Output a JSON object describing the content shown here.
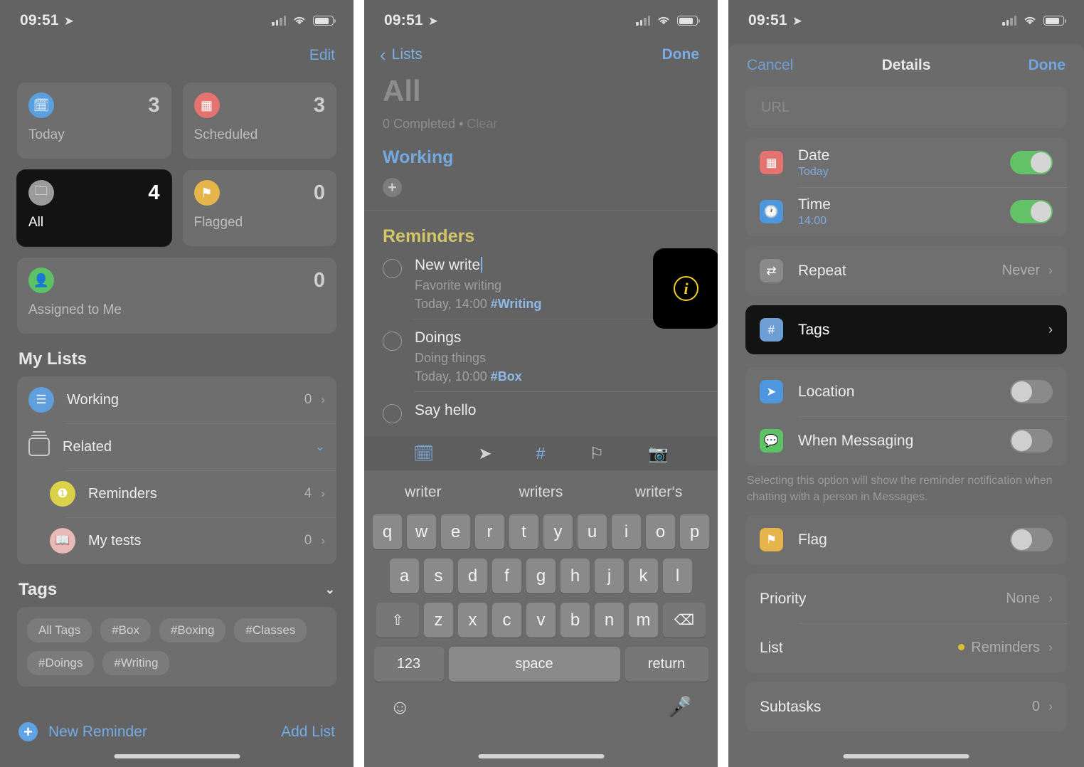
{
  "status_bar": {
    "time": "09:51",
    "location_icon": "location-arrow-icon"
  },
  "panel1": {
    "edit_label": "Edit",
    "smart_lists": [
      {
        "label": "Today",
        "count": "3",
        "icon": "today-calendar-icon",
        "color": "#5aa0de",
        "selected": false
      },
      {
        "label": "Scheduled",
        "count": "3",
        "icon": "calendar-icon",
        "color": "#e4736f",
        "selected": false
      },
      {
        "label": "All",
        "count": "4",
        "icon": "inbox-tray-icon",
        "color": "#9b9b9b",
        "selected": true
      },
      {
        "label": "Flagged",
        "count": "0",
        "icon": "flag-icon",
        "color": "#e5b44a",
        "selected": false
      },
      {
        "label": "Assigned to Me",
        "count": "0",
        "icon": "person-icon",
        "color": "#5cc265",
        "selected": false
      }
    ],
    "my_lists_header": "My Lists",
    "lists": [
      {
        "label": "Working",
        "count": "0",
        "icon": "bulleted-list-icon",
        "color": "#5f9fdd",
        "chevron": "›",
        "indent": false
      },
      {
        "label": "Related",
        "count": "",
        "icon": "group-folder-icon",
        "color": "",
        "chevron": "⌄",
        "indent": false
      },
      {
        "label": "Reminders",
        "count": "4",
        "icon": "reminders-app-icon",
        "color": "#dcd249",
        "chevron": "›",
        "indent": true
      },
      {
        "label": "My tests",
        "count": "0",
        "icon": "book-icon",
        "color": "#e7b9b9",
        "chevron": "›",
        "indent": true
      }
    ],
    "tags_header": "Tags",
    "tags": [
      "All Tags",
      "#Box",
      "#Boxing",
      "#Classes",
      "#Doings",
      "#Writing"
    ],
    "new_reminder_label": "New Reminder",
    "add_list_label": "Add List"
  },
  "panel2": {
    "back_label": "Lists",
    "done_label": "Done",
    "title": "All",
    "completed_line": "0 Completed",
    "clear_label": "Clear",
    "group_working": "Working",
    "group_reminders": "Reminders",
    "reminders": [
      {
        "title": "New write",
        "note": "Favorite writing",
        "meta": "Today, 14:00 ",
        "tag": "#Writing",
        "editing": true
      },
      {
        "title": "Doings",
        "note": "Doing things",
        "meta": "Today, 10:00 ",
        "tag": "#Box",
        "editing": false
      },
      {
        "title": "Say hello",
        "note": "",
        "meta": "",
        "tag": "",
        "editing": false
      }
    ],
    "info_callout_icon": "info-circle-icon",
    "toolbar_icons": [
      "calendar-clock-icon",
      "location-arrow-icon",
      "hashtag-icon",
      "flag-icon",
      "camera-icon"
    ],
    "suggestions": [
      "writer",
      "writers",
      "writer‘s"
    ],
    "keyboard": {
      "row1": [
        "q",
        "w",
        "e",
        "r",
        "t",
        "y",
        "u",
        "i",
        "o",
        "p"
      ],
      "row2": [
        "a",
        "s",
        "d",
        "f",
        "g",
        "h",
        "j",
        "k",
        "l"
      ],
      "row3": [
        "z",
        "x",
        "c",
        "v",
        "b",
        "n",
        "m"
      ],
      "shift_icon": "shift-arrow-icon",
      "backspace_icon": "backspace-icon",
      "numbers_label": "123",
      "space_label": "space",
      "return_label": "return",
      "emoji_icon": "emoji-smiley-icon",
      "mic_icon": "microphone-icon"
    }
  },
  "panel3": {
    "cancel_label": "Cancel",
    "title": "Details",
    "done_label": "Done",
    "url_placeholder": "URL",
    "rows": [
      {
        "label": "Date",
        "sub": "Today",
        "icon": "calendar-icon",
        "color": "#e4736f",
        "control": "toggle-on",
        "value": ""
      },
      {
        "label": "Time",
        "sub": "14:00",
        "icon": "clock-icon",
        "color": "#4e96de",
        "control": "toggle-on",
        "value": ""
      },
      {
        "label": "Repeat",
        "sub": "",
        "icon": "repeat-icon",
        "color": "#8a8a8a",
        "control": "value",
        "value": "Never"
      },
      {
        "label": "Tags",
        "sub": "",
        "icon": "hashtag-icon",
        "color": "#6d9fd4",
        "control": "chevron",
        "value": ""
      },
      {
        "label": "Location",
        "sub": "",
        "icon": "location-arrow-icon",
        "color": "#4e96de",
        "control": "toggle-off",
        "value": ""
      },
      {
        "label": "When Messaging",
        "sub": "",
        "icon": "message-bubble-icon",
        "color": "#5cc265",
        "control": "toggle-off",
        "value": ""
      },
      {
        "label": "Flag",
        "sub": "",
        "icon": "flag-icon",
        "color": "#e5b44a",
        "control": "toggle-off",
        "value": ""
      }
    ],
    "messaging_note": "Selecting this option will show the reminder notification when chatting with a person in Messages.",
    "priority_label": "Priority",
    "priority_value": "None",
    "list_label": "List",
    "list_value": "Reminders",
    "subtasks_label": "Subtasks",
    "subtasks_value": "0"
  }
}
